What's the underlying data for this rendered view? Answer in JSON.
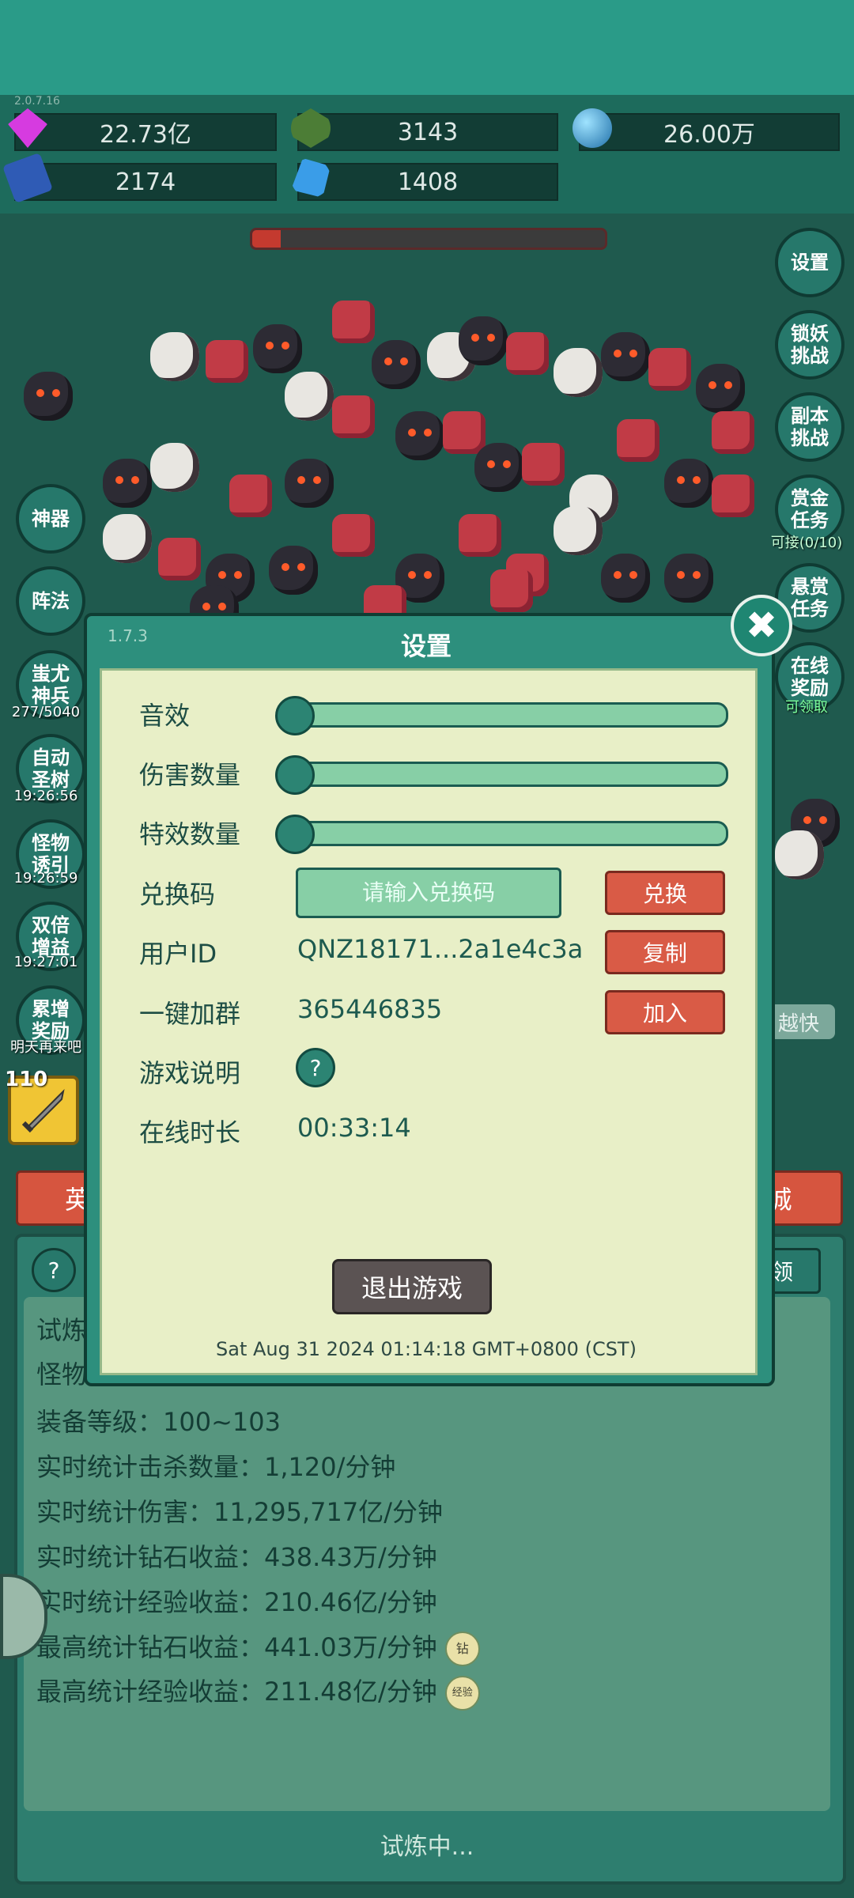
{
  "hud": {
    "version": "2.0.7.16",
    "resources": [
      {
        "name": "diamond",
        "value": "22.73亿",
        "icon": "diamond-icon",
        "color": "#d63be0"
      },
      {
        "name": "green-gem",
        "value": "3143",
        "icon": "green-gem-icon",
        "color": "#4c7d36"
      },
      {
        "name": "orb",
        "value": "26.00万",
        "icon": "blue-orb-icon",
        "color": "#3fa3d8"
      },
      {
        "name": "book",
        "value": "2174",
        "icon": "book-icon",
        "color": "#2f5bb5"
      },
      {
        "name": "blue-crystal",
        "value": "1408",
        "icon": "blue-crystal-icon",
        "color": "#3a9de8"
      }
    ],
    "stage_progress": 0.08
  },
  "right_menu": [
    {
      "label": "设置"
    },
    {
      "label": "锁妖\n挑战"
    },
    {
      "label": "副本\n挑战"
    },
    {
      "label": "赏金\n任务",
      "sub": "可接(0/10)"
    },
    {
      "label": "悬赏\n任务"
    },
    {
      "label": "在线\n奖励",
      "sub": "可领取"
    }
  ],
  "left_menu": [
    {
      "label": "神器"
    },
    {
      "label": "阵法"
    },
    {
      "label": "蚩尤\n神兵",
      "sub": "277/5040"
    },
    {
      "label": "自动\n圣树",
      "sub": "19:26:56"
    },
    {
      "label": "怪物\n诱引",
      "sub": "19:26:59"
    },
    {
      "label": "双倍\n增益",
      "sub": "19:27:01"
    },
    {
      "label": "累增\n奖励",
      "sub": "明天再来吧"
    }
  ],
  "weapon": {
    "level": "110"
  },
  "chat_hint": "越快",
  "bottom": {
    "hero_tab": "英",
    "shop_tab": "城",
    "help": "?",
    "right_tab": "领",
    "stats": [
      {
        "text": "试炼"
      },
      {
        "text": "怪物"
      },
      {
        "text": "装备等级：100~103"
      },
      {
        "text": "实时统计击杀数量：1,120/分钟"
      },
      {
        "text": "实时统计伤害：11,295,717亿/分钟"
      },
      {
        "text": "实时统计钻石收益：438.43万/分钟"
      },
      {
        "text": "实时统计经验收益：210.46亿/分钟"
      },
      {
        "text": "最高统计钻石收益：441.03万/分钟",
        "badge": "钻"
      },
      {
        "text": "最高统计经验收益：211.48亿/分钟",
        "badge": "经验"
      }
    ],
    "status": "试炼中..."
  },
  "dialog": {
    "version": "1.7.3",
    "title": "设置",
    "close": "✖",
    "rows": {
      "sound_label": "音效",
      "damage_label": "伤害数量",
      "effect_label": "特效数量",
      "code_label": "兑换码",
      "code_placeholder": "请输入兑换码",
      "code_button": "兑换",
      "uid_label": "用户ID",
      "uid_value": "QNZ18171...2a1e4c3a",
      "uid_button": "复制",
      "group_label": "一键加群",
      "group_value": "365446835",
      "group_button": "加入",
      "guide_label": "游戏说明",
      "guide_icon": "?",
      "online_label": "在线时长",
      "online_value": "00:33:14"
    },
    "sliders": {
      "sound": 0,
      "damage": 0,
      "effect": 0
    },
    "exit_button": "退出游戏",
    "timestamp": "Sat Aug 31 2024 01:14:18 GMT+0800 (CST)"
  }
}
